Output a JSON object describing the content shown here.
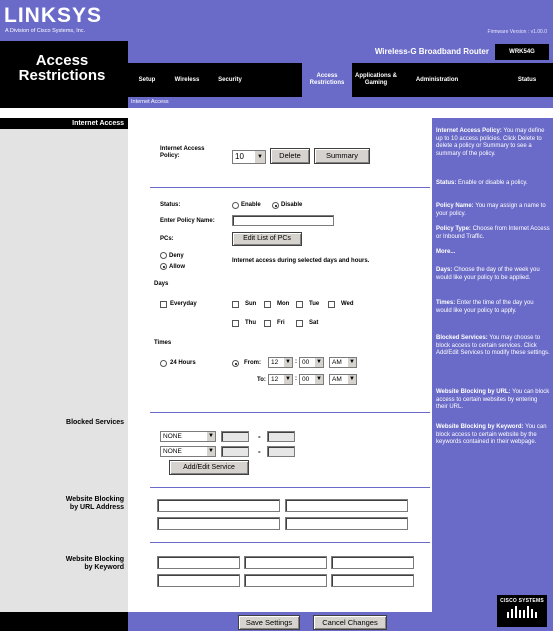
{
  "header": {
    "logo": "LINKSYS",
    "logo_sub": "A Division of Cisco Systems, Inc.",
    "firmware": "Firmware Version : v1.00.0",
    "page_title_line1": "Access",
    "page_title_line2": "Restrictions",
    "product_name": "Wireless-G Broadband Router",
    "model": "WRK54G"
  },
  "tabs": [
    {
      "label": "Setup"
    },
    {
      "label": "Wireless"
    },
    {
      "label": "Security"
    },
    {
      "label": "Access Restrictions"
    },
    {
      "label": "Applications & Gaming"
    },
    {
      "label": "Administration"
    },
    {
      "label": "Status"
    }
  ],
  "sub_tab": "Internet Access",
  "sections": {
    "internet_access": "Internet Access",
    "blocked_services": "Blocked Services",
    "website_url_line1": "Website Blocking",
    "website_url_line2": "by URL Address",
    "website_kw_line1": "Website Blocking",
    "website_kw_line2": "by Keyword"
  },
  "policy": {
    "label_line1": "Internet Access",
    "label_line2": "Policy:",
    "selected": "10",
    "delete_label": "Delete",
    "summary_label": "Summary"
  },
  "status": {
    "label": "Status:",
    "enable": "Enable",
    "disable": "Disable",
    "selected": "Disable"
  },
  "policy_name": {
    "label": "Enter Policy Name:",
    "value": ""
  },
  "pcs": {
    "label": "PCs:",
    "button": "Edit List of PCs"
  },
  "access": {
    "deny": "Deny",
    "allow": "Allow",
    "selected": "Allow",
    "description": "Internet access during selected days and hours."
  },
  "days": {
    "label": "Days",
    "everyday": "Everyday",
    "items": [
      "Sun",
      "Mon",
      "Tue",
      "Wed",
      "Thu",
      "Fri",
      "Sat"
    ]
  },
  "times": {
    "label": "Times",
    "all_day": "24 Hours",
    "from_label": "From:",
    "to_label": "To:",
    "from_hour": "12",
    "from_min": "00",
    "from_ampm": "AM",
    "to_hour": "12",
    "to_min": "00",
    "to_ampm": "AM",
    "separator": ":"
  },
  "blocked_services": {
    "rows": [
      {
        "service": "NONE",
        "dash": "-"
      },
      {
        "service": "NONE",
        "dash": "-"
      }
    ],
    "add_edit": "Add/Edit Service"
  },
  "buttons": {
    "save": "Save Settings",
    "cancel": "Cancel Changes"
  },
  "help": [
    {
      "title": "Internet Access Policy:",
      "text": " You may define up to 10 access policies. Click Delete to delete a policy or Summary to see a summary of the policy."
    },
    {
      "title": "Status:",
      "text": " Enable or disable a policy."
    },
    {
      "title": "Policy Name:",
      "text": " You may assign a name to your policy."
    },
    {
      "title": "Policy Type:",
      "text": " Choose from Internet Access or Inbound Traffic."
    },
    {
      "title": "More...",
      "text": ""
    },
    {
      "title": "Days:",
      "text": " Choose the day of the week you would like your policy to be applied."
    },
    {
      "title": "Times:",
      "text": " Enter the time of the day you would like your policy to apply."
    },
    {
      "title": "Blocked Services:",
      "text": " You may choose to block access to certain services. Click Add/Edit Services to modify these settings."
    },
    {
      "title": "Website Blocking by URL:",
      "text": " You can block access to certain websites by entering their URL."
    },
    {
      "title": "Website Blocking by Keyword:",
      "text": " You can block access to certain website by the keywords contained in their webpage."
    }
  ],
  "footer": {
    "cisco": "CISCO SYSTEMS"
  },
  "colors": {
    "brand": "#6a6ac8",
    "black": "#000000",
    "panel": "#e3e3e3"
  }
}
